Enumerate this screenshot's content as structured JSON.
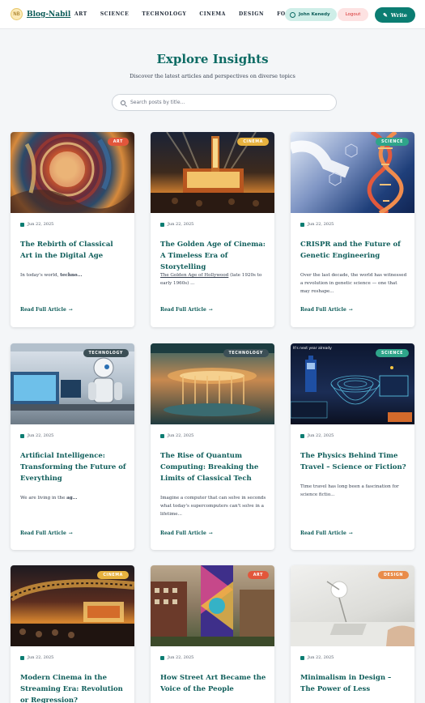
{
  "brand": {
    "name": "Blog-Nabil",
    "mark": "NB"
  },
  "nav": [
    "ART",
    "SCIENCE",
    "TECHNOLOGY",
    "CINEMA",
    "DESIGN",
    "FOOD"
  ],
  "user": {
    "name": "John Kenedy"
  },
  "buttons": {
    "logout": "Logout",
    "write": "Write"
  },
  "hero": {
    "title": "Explore Insights",
    "subtitle": "Discover the latest articles and perspectives on diverse topics"
  },
  "search": {
    "placeholder": "Search posts by title..."
  },
  "read_more": "Read Full Article",
  "colors": {
    "accent": "#0b7d72",
    "title": "#0d5c59",
    "art": "#e2563b",
    "cinema": "#e7b23f",
    "science": "#2fa58a",
    "technology": "#3c4f56",
    "design": "#e98c4a"
  },
  "posts": [
    {
      "category": "ART",
      "date": "Jun 22, 2025",
      "title": "The Rebirth of Classical Art in the Digital Age",
      "excerpt": "In today's world, ",
      "excerpt_bold": "techno...",
      "excerpt_tail": "",
      "image": "art-fresco-collage"
    },
    {
      "category": "CINEMA",
      "date": "Jun 22, 2025",
      "title": "The Golden Age of Cinema: A Timeless Era of Storytelling",
      "excerpt_link": "The Golden Age of Hollywood",
      "excerpt": " (late 1920s to early 1960s) ...",
      "image": "vintage-theater-marquee"
    },
    {
      "category": "SCIENCE",
      "date": "Jun 22, 2025",
      "title": "CRISPR and the Future of Genetic Engineering",
      "excerpt": "Over the last decade, the world has witnessed a revolution in genetic science — one that may reshape...",
      "image": "dna-helix-editing"
    },
    {
      "category": "TECHNOLOGY",
      "date": "Jun 22, 2025",
      "title": "Artificial Intelligence: Transforming the Future of Everything",
      "excerpt": "We are living in the ",
      "excerpt_bold": "ag...",
      "image": "robot-at-monitors"
    },
    {
      "category": "TECHNOLOGY",
      "date": "Jun 22, 2025",
      "title": "The Rise of Quantum Computing: Breaking the Limits of Classical Tech",
      "excerpt": "Imagine a computer that can solve in seconds what today's supercomputers can't solve in a lifetime...",
      "image": "quantum-chandelier"
    },
    {
      "category": "SCIENCE",
      "date": "Jun 22, 2025",
      "title": "The Physics Behind Time Travel – Science or Fiction?",
      "excerpt": "Time travel has long been a fascination for science fictio...",
      "image": "wormhole-police-box",
      "image_caption": "It's next year already"
    },
    {
      "category": "CINEMA",
      "date": "Jun 22, 2025",
      "title": "Modern Cinema in the Streaming Era: Revolution or Regression?",
      "excerpt": "",
      "image": "film-reel-crowd"
    },
    {
      "category": "ART",
      "date": "Jun 22, 2025",
      "title": "How Street Art Became the Voice of the People",
      "excerpt": "",
      "image": "mural-on-building"
    },
    {
      "category": "DESIGN",
      "date": "Jun 22, 2025",
      "title": "Minimalism in Design – The Power of Less",
      "excerpt": "",
      "image": "minimal-desk-lamp"
    }
  ]
}
